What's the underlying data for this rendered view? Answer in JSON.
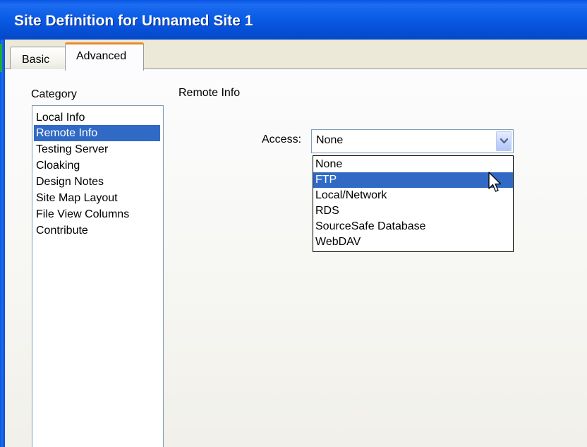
{
  "window": {
    "title": "Site Definition for Unnamed Site 1"
  },
  "tabs": [
    {
      "label": "Basic",
      "active": false
    },
    {
      "label": "Advanced",
      "active": true
    }
  ],
  "category": {
    "heading": "Category",
    "items": [
      {
        "label": "Local Info",
        "selected": false
      },
      {
        "label": "Remote Info",
        "selected": true
      },
      {
        "label": "Testing Server",
        "selected": false
      },
      {
        "label": "Cloaking",
        "selected": false
      },
      {
        "label": "Design Notes",
        "selected": false
      },
      {
        "label": "Site Map Layout",
        "selected": false
      },
      {
        "label": "File View Columns",
        "selected": false
      },
      {
        "label": "Contribute",
        "selected": false
      }
    ]
  },
  "section": {
    "heading": "Remote Info"
  },
  "access": {
    "label": "Access:",
    "value": "None",
    "options": [
      {
        "label": "None",
        "highlighted": false
      },
      {
        "label": "FTP",
        "highlighted": true
      },
      {
        "label": "Local/Network",
        "highlighted": false
      },
      {
        "label": "RDS",
        "highlighted": false
      },
      {
        "label": "SourceSafe Database",
        "highlighted": false
      },
      {
        "label": "WebDAV",
        "highlighted": false
      }
    ]
  },
  "icons": {
    "dropdown_button": "chevron-down-icon",
    "cursor": "mouse-pointer-icon"
  },
  "colors": {
    "titlebar": "#0a5ce6",
    "selection": "#316ac5",
    "active_tab_accent": "#e68b2c",
    "dialog_background": "#ece9d8"
  }
}
